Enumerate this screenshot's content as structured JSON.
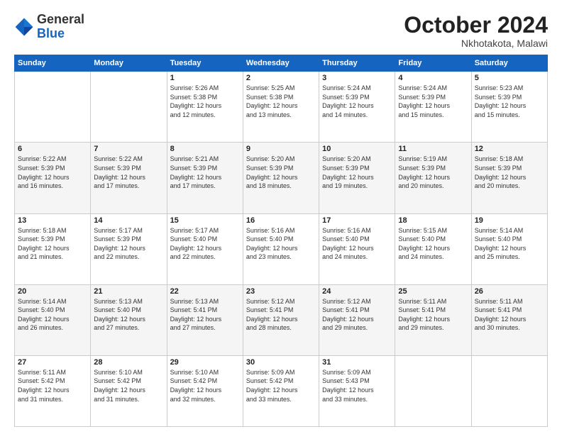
{
  "header": {
    "logo_general": "General",
    "logo_blue": "Blue",
    "month_title": "October 2024",
    "subtitle": "Nkhotakota, Malawi"
  },
  "weekdays": [
    "Sunday",
    "Monday",
    "Tuesday",
    "Wednesday",
    "Thursday",
    "Friday",
    "Saturday"
  ],
  "weeks": [
    [
      {
        "day": "",
        "info": ""
      },
      {
        "day": "",
        "info": ""
      },
      {
        "day": "1",
        "info": "Sunrise: 5:26 AM\nSunset: 5:38 PM\nDaylight: 12 hours\nand 12 minutes."
      },
      {
        "day": "2",
        "info": "Sunrise: 5:25 AM\nSunset: 5:38 PM\nDaylight: 12 hours\nand 13 minutes."
      },
      {
        "day": "3",
        "info": "Sunrise: 5:24 AM\nSunset: 5:39 PM\nDaylight: 12 hours\nand 14 minutes."
      },
      {
        "day": "4",
        "info": "Sunrise: 5:24 AM\nSunset: 5:39 PM\nDaylight: 12 hours\nand 15 minutes."
      },
      {
        "day": "5",
        "info": "Sunrise: 5:23 AM\nSunset: 5:39 PM\nDaylight: 12 hours\nand 15 minutes."
      }
    ],
    [
      {
        "day": "6",
        "info": "Sunrise: 5:22 AM\nSunset: 5:39 PM\nDaylight: 12 hours\nand 16 minutes."
      },
      {
        "day": "7",
        "info": "Sunrise: 5:22 AM\nSunset: 5:39 PM\nDaylight: 12 hours\nand 17 minutes."
      },
      {
        "day": "8",
        "info": "Sunrise: 5:21 AM\nSunset: 5:39 PM\nDaylight: 12 hours\nand 17 minutes."
      },
      {
        "day": "9",
        "info": "Sunrise: 5:20 AM\nSunset: 5:39 PM\nDaylight: 12 hours\nand 18 minutes."
      },
      {
        "day": "10",
        "info": "Sunrise: 5:20 AM\nSunset: 5:39 PM\nDaylight: 12 hours\nand 19 minutes."
      },
      {
        "day": "11",
        "info": "Sunrise: 5:19 AM\nSunset: 5:39 PM\nDaylight: 12 hours\nand 20 minutes."
      },
      {
        "day": "12",
        "info": "Sunrise: 5:18 AM\nSunset: 5:39 PM\nDaylight: 12 hours\nand 20 minutes."
      }
    ],
    [
      {
        "day": "13",
        "info": "Sunrise: 5:18 AM\nSunset: 5:39 PM\nDaylight: 12 hours\nand 21 minutes."
      },
      {
        "day": "14",
        "info": "Sunrise: 5:17 AM\nSunset: 5:39 PM\nDaylight: 12 hours\nand 22 minutes."
      },
      {
        "day": "15",
        "info": "Sunrise: 5:17 AM\nSunset: 5:40 PM\nDaylight: 12 hours\nand 22 minutes."
      },
      {
        "day": "16",
        "info": "Sunrise: 5:16 AM\nSunset: 5:40 PM\nDaylight: 12 hours\nand 23 minutes."
      },
      {
        "day": "17",
        "info": "Sunrise: 5:16 AM\nSunset: 5:40 PM\nDaylight: 12 hours\nand 24 minutes."
      },
      {
        "day": "18",
        "info": "Sunrise: 5:15 AM\nSunset: 5:40 PM\nDaylight: 12 hours\nand 24 minutes."
      },
      {
        "day": "19",
        "info": "Sunrise: 5:14 AM\nSunset: 5:40 PM\nDaylight: 12 hours\nand 25 minutes."
      }
    ],
    [
      {
        "day": "20",
        "info": "Sunrise: 5:14 AM\nSunset: 5:40 PM\nDaylight: 12 hours\nand 26 minutes."
      },
      {
        "day": "21",
        "info": "Sunrise: 5:13 AM\nSunset: 5:40 PM\nDaylight: 12 hours\nand 27 minutes."
      },
      {
        "day": "22",
        "info": "Sunrise: 5:13 AM\nSunset: 5:41 PM\nDaylight: 12 hours\nand 27 minutes."
      },
      {
        "day": "23",
        "info": "Sunrise: 5:12 AM\nSunset: 5:41 PM\nDaylight: 12 hours\nand 28 minutes."
      },
      {
        "day": "24",
        "info": "Sunrise: 5:12 AM\nSunset: 5:41 PM\nDaylight: 12 hours\nand 29 minutes."
      },
      {
        "day": "25",
        "info": "Sunrise: 5:11 AM\nSunset: 5:41 PM\nDaylight: 12 hours\nand 29 minutes."
      },
      {
        "day": "26",
        "info": "Sunrise: 5:11 AM\nSunset: 5:41 PM\nDaylight: 12 hours\nand 30 minutes."
      }
    ],
    [
      {
        "day": "27",
        "info": "Sunrise: 5:11 AM\nSunset: 5:42 PM\nDaylight: 12 hours\nand 31 minutes."
      },
      {
        "day": "28",
        "info": "Sunrise: 5:10 AM\nSunset: 5:42 PM\nDaylight: 12 hours\nand 31 minutes."
      },
      {
        "day": "29",
        "info": "Sunrise: 5:10 AM\nSunset: 5:42 PM\nDaylight: 12 hours\nand 32 minutes."
      },
      {
        "day": "30",
        "info": "Sunrise: 5:09 AM\nSunset: 5:42 PM\nDaylight: 12 hours\nand 33 minutes."
      },
      {
        "day": "31",
        "info": "Sunrise: 5:09 AM\nSunset: 5:43 PM\nDaylight: 12 hours\nand 33 minutes."
      },
      {
        "day": "",
        "info": ""
      },
      {
        "day": "",
        "info": ""
      }
    ]
  ]
}
